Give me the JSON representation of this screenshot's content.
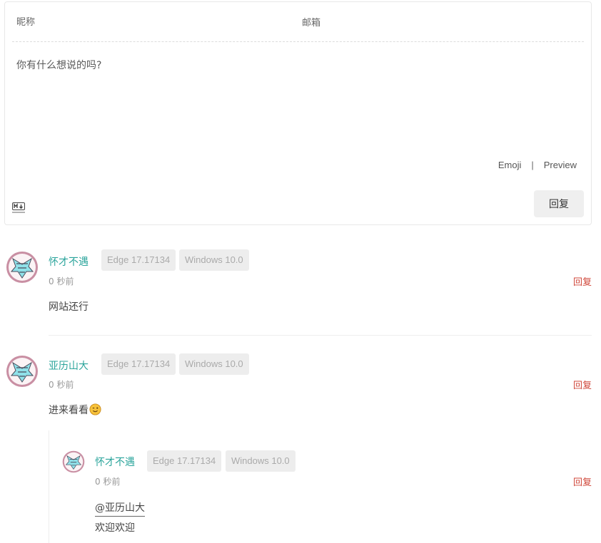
{
  "form": {
    "nick_placeholder": "昵称",
    "mail_placeholder": "邮箱",
    "editor_placeholder": "你有什么想说的吗?",
    "emoji_label": "Emoji",
    "separator": "|",
    "preview_label": "Preview",
    "markdown_icon": "markdown-icon",
    "submit_label": "回复"
  },
  "comments": [
    {
      "author": "怀才不遇",
      "browser": "Edge 17.17134",
      "os": "Windows 10.0",
      "time": "0 秒前",
      "reply_label": "回复",
      "text": "网站还行"
    },
    {
      "author": "亚历山大",
      "browser": "Edge 17.17134",
      "os": "Windows 10.0",
      "time": "0 秒前",
      "reply_label": "回复",
      "text": "进来看看",
      "emoji": "winking-face-emoji",
      "replies": [
        {
          "author": "怀才不遇",
          "browser": "Edge 17.17134",
          "os": "Windows 10.0",
          "time": "0 秒前",
          "reply_label": "回复",
          "mention": "@亚历山大",
          "text": "欢迎欢迎"
        }
      ]
    }
  ],
  "colors": {
    "author": "#2aa49b",
    "reply": "#d0473a",
    "badge_bg": "#ededed",
    "badge_text": "#aaaaaa",
    "button_bg": "#efefef"
  }
}
